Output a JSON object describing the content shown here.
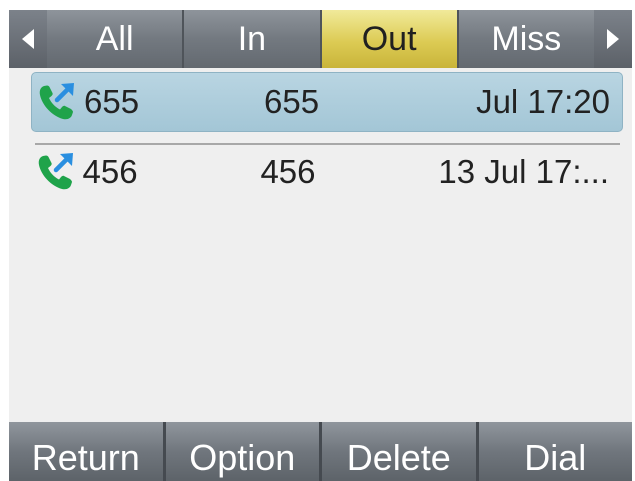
{
  "tabs": {
    "items": [
      {
        "label": "All",
        "active": false
      },
      {
        "label": "In",
        "active": false
      },
      {
        "label": "Out",
        "active": true
      },
      {
        "label": "Miss",
        "active": false
      }
    ]
  },
  "calls": [
    {
      "name": "655",
      "number": "655",
      "time": "Jul 17:20",
      "type": "outgoing",
      "selected": true
    },
    {
      "name": "456",
      "number": "456",
      "time": "13 Jul 17:...",
      "type": "outgoing",
      "selected": false
    }
  ],
  "softkeys": {
    "return_label": "Return",
    "option_label": "Option",
    "delete_label": "Delete",
    "dial_label": "Dial"
  },
  "colors": {
    "active_tab": "#dccb54",
    "selected_row": "#a3c6d6",
    "call_icon_green": "#1fa34a",
    "call_icon_blue": "#2a8fe0"
  }
}
